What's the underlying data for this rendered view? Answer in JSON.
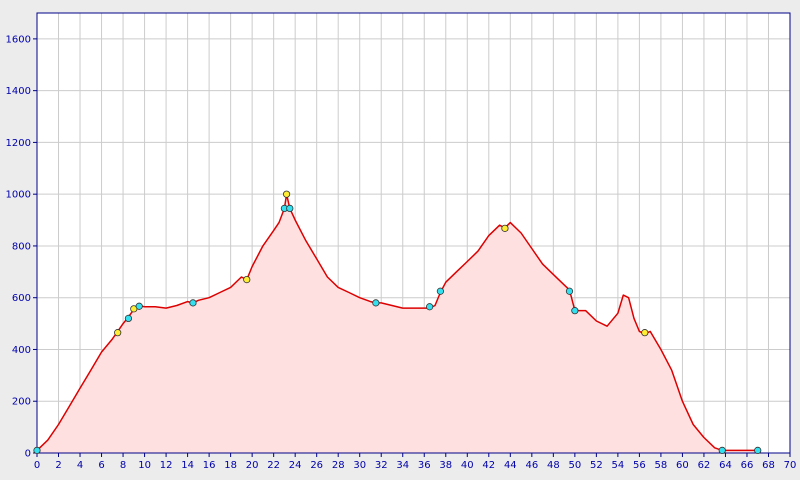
{
  "chart_data": {
    "type": "area",
    "title": "",
    "xlabel": "",
    "ylabel": "",
    "xlim": [
      0,
      70
    ],
    "ylim": [
      0,
      1700
    ],
    "x_ticks": [
      0,
      2,
      4,
      6,
      8,
      10,
      12,
      14,
      16,
      18,
      20,
      22,
      24,
      26,
      28,
      30,
      32,
      34,
      36,
      38,
      40,
      42,
      44,
      46,
      48,
      50,
      52,
      54,
      56,
      58,
      60,
      62,
      64,
      66,
      68,
      70
    ],
    "y_ticks": [
      0,
      200,
      400,
      600,
      800,
      1000,
      1200,
      1400,
      1600
    ],
    "grid": true,
    "colors": {
      "line": "#dd0000",
      "fill": "#ffe0e0",
      "grid": "#cccccc",
      "plot_background": "#ffffff",
      "axis": "#000088",
      "tick_label": "#0000aa",
      "marker_cyan": "#33e0f0",
      "marker_yellow": "#ffee33"
    },
    "series": [
      {
        "name": "",
        "x": [
          0,
          1,
          2,
          3,
          4,
          5,
          6,
          7,
          7.5,
          8,
          8.5,
          9,
          9.5,
          10,
          11,
          12,
          13,
          14,
          14.5,
          15,
          16,
          17,
          18,
          19,
          19.5,
          20,
          21,
          22,
          22.5,
          23,
          23.2,
          23.5,
          24,
          25,
          26,
          27,
          28,
          29,
          30,
          31,
          31.5,
          32,
          33,
          34,
          35,
          36,
          36.5,
          37,
          37.5,
          38,
          39,
          40,
          41,
          42,
          43,
          43.5,
          44,
          45,
          46,
          47,
          48,
          49,
          49.5,
          50,
          50.5,
          51,
          52,
          53,
          54,
          54.5,
          55,
          55.5,
          56,
          56.5,
          57,
          58,
          59,
          60,
          61,
          62,
          63,
          63.7,
          64,
          65,
          66,
          67
        ],
        "y": [
          10,
          50,
          110,
          180,
          250,
          320,
          390,
          440,
          470,
          500,
          525,
          555,
          570,
          565,
          565,
          560,
          570,
          585,
          580,
          590,
          600,
          620,
          640,
          680,
          670,
          720,
          800,
          860,
          890,
          945,
          1000,
          945,
          900,
          820,
          750,
          680,
          640,
          620,
          600,
          585,
          580,
          580,
          570,
          560,
          560,
          560,
          560,
          570,
          620,
          660,
          700,
          740,
          780,
          840,
          880,
          870,
          890,
          850,
          790,
          730,
          690,
          650,
          630,
          550,
          550,
          550,
          510,
          490,
          540,
          610,
          600,
          520,
          470,
          460,
          470,
          400,
          320,
          200,
          110,
          60,
          20,
          10,
          10,
          10,
          10,
          10
        ]
      }
    ],
    "markers": [
      {
        "x": 0,
        "y": 10,
        "color": "cyan"
      },
      {
        "x": 7.5,
        "y": 465,
        "color": "yellow"
      },
      {
        "x": 8.5,
        "y": 520,
        "color": "cyan"
      },
      {
        "x": 9,
        "y": 557,
        "color": "yellow"
      },
      {
        "x": 9.5,
        "y": 567,
        "color": "cyan"
      },
      {
        "x": 14.5,
        "y": 580,
        "color": "cyan"
      },
      {
        "x": 19.5,
        "y": 670,
        "color": "yellow"
      },
      {
        "x": 23,
        "y": 945,
        "color": "cyan"
      },
      {
        "x": 23.2,
        "y": 1000,
        "color": "yellow"
      },
      {
        "x": 23.5,
        "y": 945,
        "color": "cyan"
      },
      {
        "x": 31.5,
        "y": 580,
        "color": "cyan"
      },
      {
        "x": 36.5,
        "y": 565,
        "color": "cyan"
      },
      {
        "x": 37.5,
        "y": 625,
        "color": "cyan"
      },
      {
        "x": 43.5,
        "y": 868,
        "color": "yellow"
      },
      {
        "x": 49.5,
        "y": 625,
        "color": "cyan"
      },
      {
        "x": 50,
        "y": 550,
        "color": "cyan"
      },
      {
        "x": 56.5,
        "y": 465,
        "color": "yellow"
      },
      {
        "x": 63.7,
        "y": 10,
        "color": "cyan"
      },
      {
        "x": 67,
        "y": 10,
        "color": "cyan"
      }
    ]
  }
}
